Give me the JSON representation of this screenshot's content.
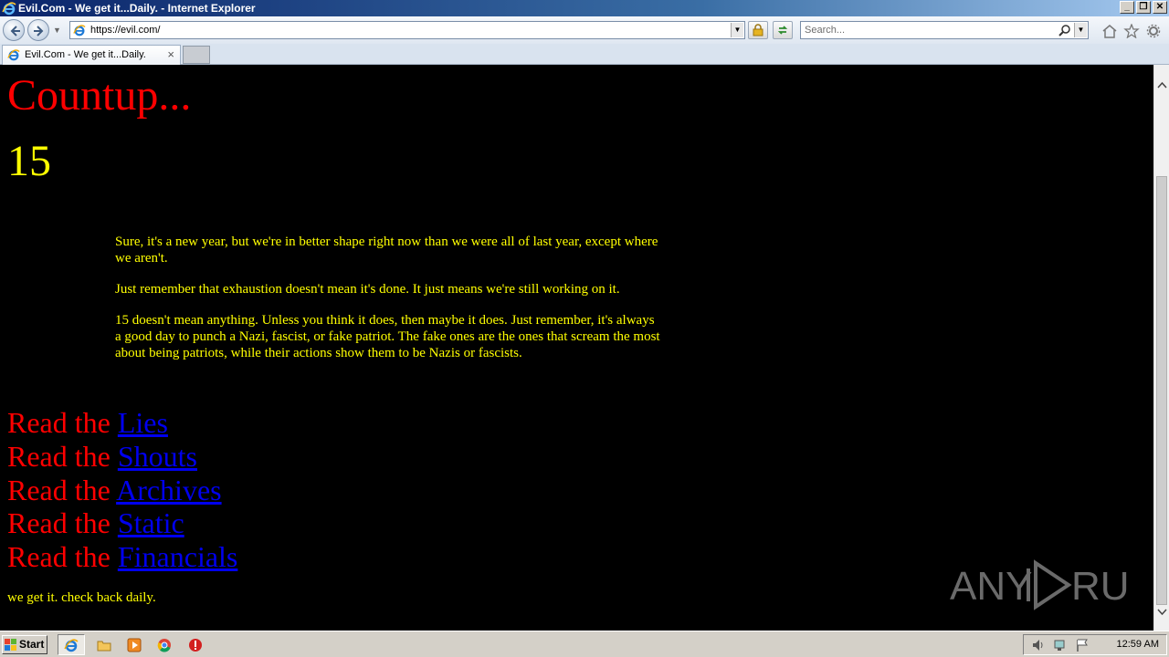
{
  "window": {
    "title": "Evil.Com - We get it...Daily. - Internet Explorer",
    "controls": [
      "_",
      "❐",
      "✕"
    ]
  },
  "navbar": {
    "address": "https://evil.com/",
    "search_placeholder": "Search..."
  },
  "tabs": [
    {
      "label": "Evil.Com - We get it...Daily."
    }
  ],
  "page": {
    "heading": "Countup...",
    "count": "15",
    "paragraphs": [
      "Sure, it's a new year, but we're in better shape right now than we were all of last year, except where we aren't.",
      "Just remember that exhaustion doesn't mean it's done. It just means we're still working on it.",
      "15 doesn't mean anything. Unless you think it does, then maybe it does. Just remember, it's always a good day to punch a Nazi, fascist, or fake patriot. The fake ones are the ones that scream the most about being patriots, while their actions show them to be Nazis or fascists."
    ],
    "read_prefix": "Read the",
    "links": [
      "Lies",
      "Shouts",
      "Archives",
      "Static",
      "Financials"
    ],
    "footer": "we get it.  check back daily."
  },
  "watermark": "ANY RUN",
  "taskbar": {
    "start_label": "Start",
    "clock": "12:59 AM"
  },
  "colors": {
    "heading": "#ff0000",
    "text": "#ffff00",
    "link": "#0000ee",
    "background": "#000000"
  },
  "icons": [
    "ie-icon",
    "back-arrow-icon",
    "forward-arrow-icon",
    "lock-icon",
    "refresh-icon",
    "search-icon",
    "home-icon",
    "star-icon",
    "gear-icon",
    "folder-icon",
    "media-player-icon",
    "chrome-icon",
    "stop-icon",
    "volume-icon",
    "network-icon",
    "flag-icon"
  ]
}
